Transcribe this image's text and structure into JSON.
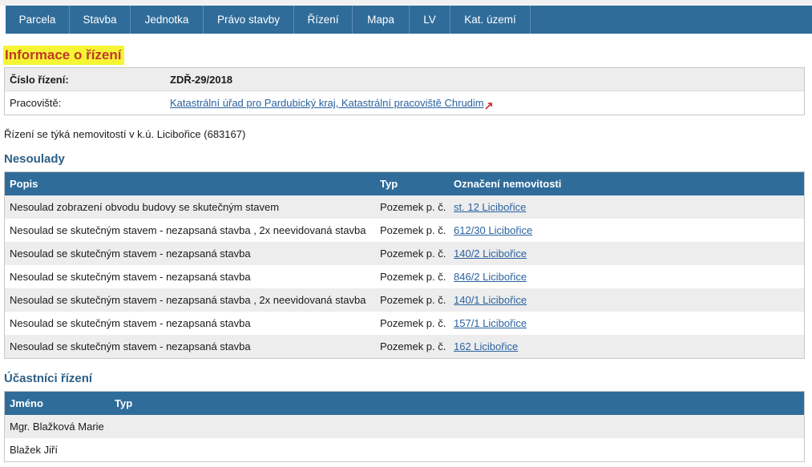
{
  "nav": {
    "items": [
      "Parcela",
      "Stavba",
      "Jednotka",
      "Právo stavby",
      "Řízení",
      "Mapa",
      "LV",
      "Kat. území"
    ]
  },
  "page_title": "Informace o řízení",
  "info": {
    "cislo_label": "Číslo řízení:",
    "cislo_value": "ZDŘ-29/2018",
    "pracoviste_label": "Pracoviště:",
    "pracoviste_value": "Katastrální úřad pro Pardubický kraj, Katastrální pracoviště Chrudim"
  },
  "note": "Řízení se týká nemovitostí v k.ú. Licibořice (683167)",
  "nesoulady": {
    "title": "Nesoulady",
    "headers": {
      "popis": "Popis",
      "typ": "Typ",
      "oznaceni": "Označení nemovitosti"
    },
    "rows": [
      {
        "popis": "Nesoulad zobrazení obvodu budovy se skutečným stavem",
        "typ": "Pozemek p. č.",
        "oznaceni": "st. 12 Licibořice"
      },
      {
        "popis": "Nesoulad se skutečným stavem - nezapsaná stavba , 2x neevidovaná stavba",
        "typ": "Pozemek p. č.",
        "oznaceni": "612/30 Licibořice"
      },
      {
        "popis": "Nesoulad se skutečným stavem - nezapsaná stavba",
        "typ": "Pozemek p. č.",
        "oznaceni": "140/2 Licibořice"
      },
      {
        "popis": "Nesoulad se skutečným stavem - nezapsaná stavba",
        "typ": "Pozemek p. č.",
        "oznaceni": "846/2 Licibořice"
      },
      {
        "popis": "Nesoulad se skutečným stavem - nezapsaná stavba , 2x neevidovaná stavba",
        "typ": "Pozemek p. č.",
        "oznaceni": "140/1 Licibořice"
      },
      {
        "popis": "Nesoulad se skutečným stavem - nezapsaná stavba",
        "typ": "Pozemek p. č.",
        "oznaceni": "157/1 Licibořice"
      },
      {
        "popis": "Nesoulad se skutečným stavem - nezapsaná stavba",
        "typ": "Pozemek p. č.",
        "oznaceni": "162 Licibořice"
      }
    ]
  },
  "ucastnici": {
    "title": "Účastníci řízení",
    "headers": {
      "jmeno": "Jméno",
      "typ": "Typ"
    },
    "rows": [
      {
        "jmeno": "Mgr. Blažková Marie",
        "typ": ""
      },
      {
        "jmeno": "Blažek Jiří",
        "typ": ""
      }
    ]
  },
  "colors": {
    "nav_bg": "#2f6c9a",
    "section_title": "#2d5f86",
    "link": "#2a62a0",
    "highlight": "#f5f534",
    "title_text": "#c0392b",
    "external_icon": "#d0342c"
  }
}
